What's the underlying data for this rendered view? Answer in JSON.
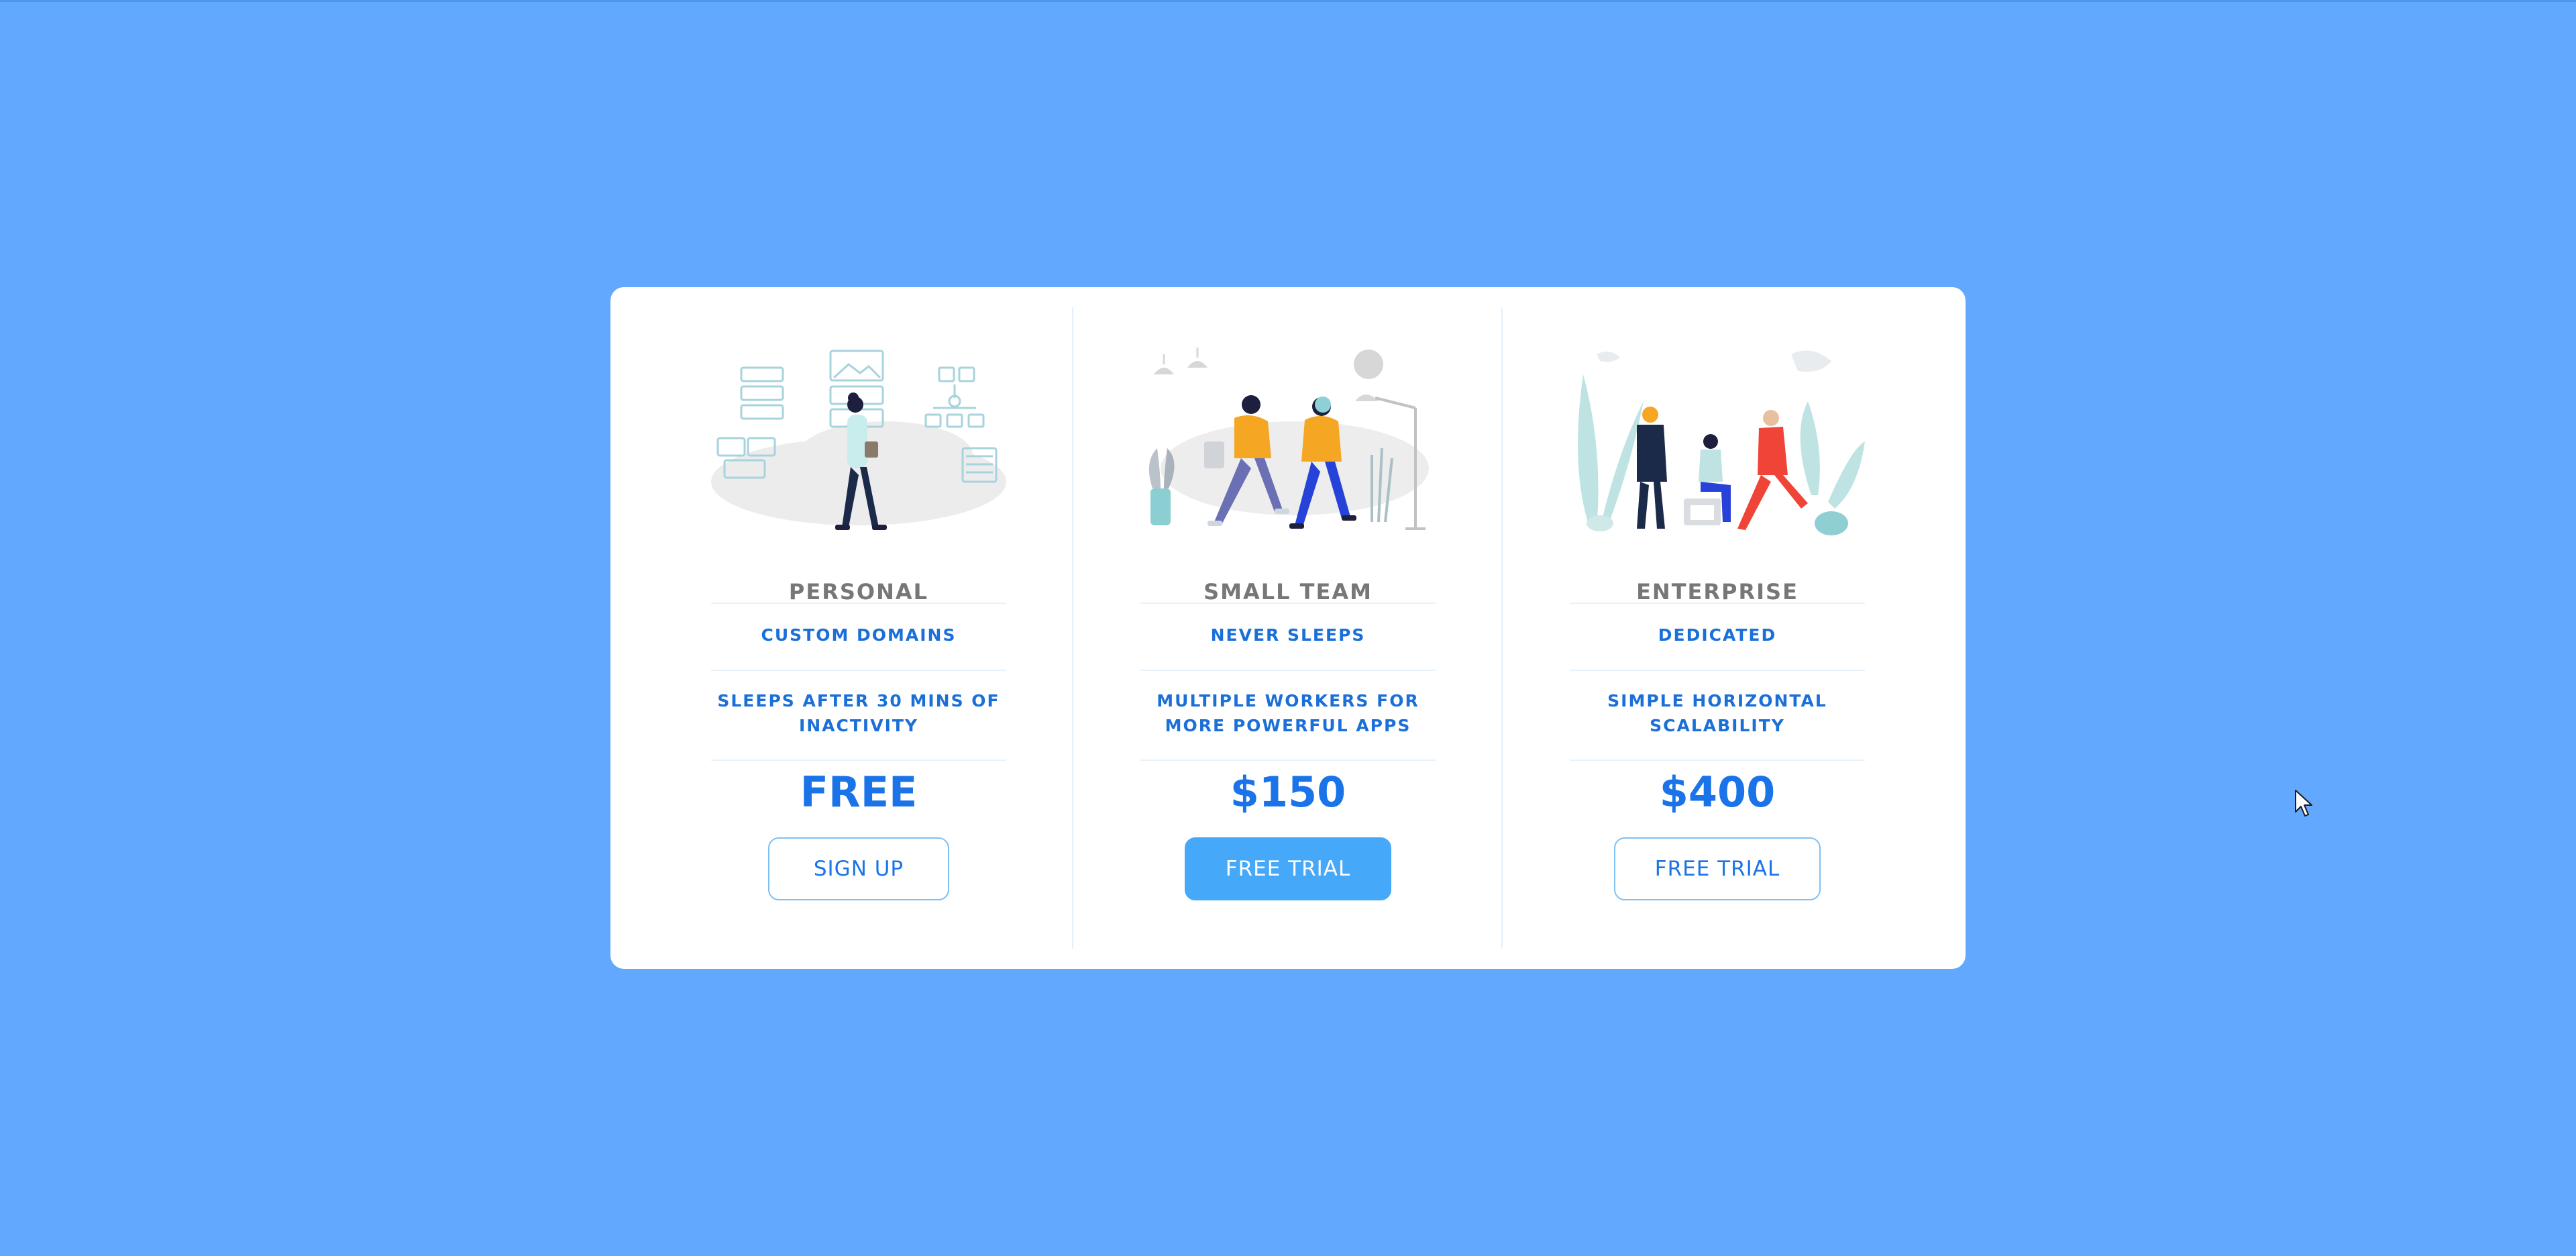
{
  "colors": {
    "background": "#61a8fe",
    "card": "#ffffff",
    "accent": "#1a73e8",
    "button_filled": "#46a8f8"
  },
  "plans": [
    {
      "name": "PERSONAL",
      "feature_1": "CUSTOM DOMAINS",
      "feature_2": "SLEEPS AFTER 30 MINS OF INACTIVITY",
      "price": "FREE",
      "button": "SIGN UP",
      "button_style": "outline",
      "illustration": "person-walking-with-ui-panels-illustration"
    },
    {
      "name": "SMALL TEAM",
      "feature_1": "NEVER SLEEPS",
      "feature_2": "MULTIPLE WORKERS FOR MORE POWERFUL APPS",
      "price": "$150",
      "button": "FREE TRIAL",
      "button_style": "filled",
      "illustration": "two-people-walking-office-illustration"
    },
    {
      "name": "ENTERPRISE",
      "feature_1": "DEDICATED",
      "feature_2": "SIMPLE HORIZONTAL SCALABILITY",
      "price": "$400",
      "button": "FREE TRIAL",
      "button_style": "outline",
      "illustration": "team-meeting-plants-illustration"
    }
  ],
  "cursor": "mouse-pointer-icon"
}
